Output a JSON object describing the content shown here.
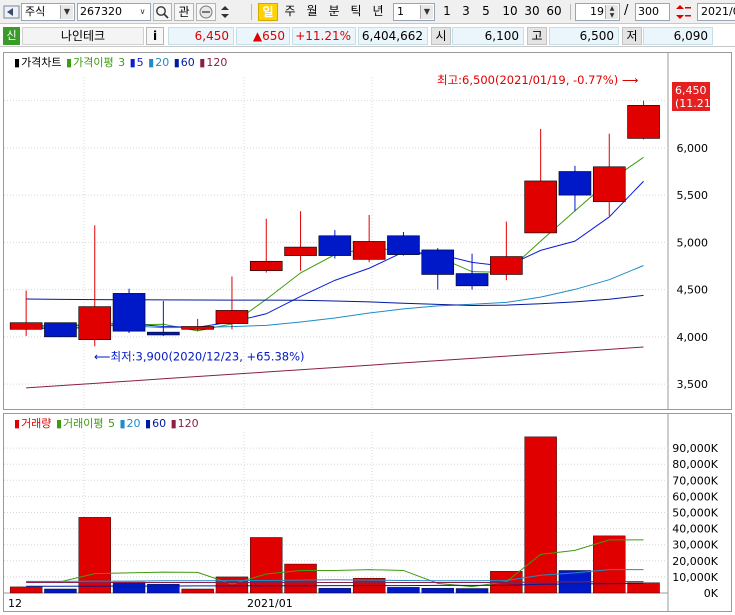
{
  "toolbar": {
    "market_select": "주식",
    "code_input": "267320",
    "search_icon": "search-icon",
    "btn_gwan": "관",
    "periods": [
      "일",
      "주",
      "월",
      "분",
      "틱",
      "년"
    ],
    "active_period": "일",
    "interval_select": "1",
    "intervals": [
      "1",
      "3",
      "5",
      "10",
      "30",
      "60"
    ],
    "count_value": "19",
    "slash": "/",
    "total_value": "300",
    "date_value": "2021/0"
  },
  "quote": {
    "badge": "신",
    "name": "나인테크",
    "info_button": "i",
    "price": "6,450",
    "change": "▲650",
    "change_pct": "+11.21%",
    "volume": "6,404,662",
    "open_label": "시",
    "open": "6,100",
    "high_label": "고",
    "high": "6,500",
    "low_label": "저",
    "low": "6,090"
  },
  "colors": {
    "up": "#e00000",
    "down": "#0019c8",
    "ma3": "#3f9b10",
    "ma5": "#0a1ed7",
    "ma20": "#1e8cc8",
    "ma60": "#001a9f",
    "ma120": "#8c1e46",
    "grid": "#d8d8d8",
    "toolbar_active": "#ffd200"
  },
  "price_legend": {
    "title": "가격차트",
    "ma_title": "가격이평",
    "ma_periods": [
      "3",
      "5",
      "20",
      "60",
      "120"
    ]
  },
  "volume_legend": {
    "title": "거래량",
    "ma_title": "거래이평",
    "ma_periods": [
      "5",
      "20",
      "60",
      "120"
    ]
  },
  "annotations": {
    "high_note": "최고:6,500(2021/01/19, -0.77%)",
    "low_note": "최저:3,900(2020/12/23, +65.38%)",
    "last_price_box": "6,450",
    "last_pct_box": "(11.21%)"
  },
  "chart_data": [
    {
      "type": "candlestick",
      "title": "가격차트",
      "ylim": [
        3300,
        6750
      ],
      "yticks": [
        3500,
        4000,
        4500,
        5000,
        5500,
        6000,
        6500
      ],
      "ytick_labels": [
        "3,500",
        "4,000",
        "4,500",
        "5,000",
        "5,500",
        "6,000",
        "6,500"
      ],
      "x_labels": [
        "12",
        "2021/01"
      ],
      "candles": [
        {
          "open": 4080,
          "high": 4490,
          "low": 4010,
          "close": 4150
        },
        {
          "open": 4150,
          "high": 4150,
          "low": 4000,
          "close": 4000
        },
        {
          "open": 3970,
          "high": 5180,
          "low": 3900,
          "close": 4320
        },
        {
          "open": 4460,
          "high": 4510,
          "low": 4040,
          "close": 4060
        },
        {
          "open": 4050,
          "high": 4380,
          "low": 4010,
          "close": 4020
        },
        {
          "open": 4080,
          "high": 4190,
          "low": 4060,
          "close": 4110
        },
        {
          "open": 4140,
          "high": 4640,
          "low": 4080,
          "close": 4280
        },
        {
          "open": 4700,
          "high": 5250,
          "low": 4680,
          "close": 4800
        },
        {
          "open": 4860,
          "high": 5330,
          "low": 4700,
          "close": 4950
        },
        {
          "open": 5070,
          "high": 5130,
          "low": 4830,
          "close": 4860
        },
        {
          "open": 4820,
          "high": 5290,
          "low": 4790,
          "close": 5010
        },
        {
          "open": 5070,
          "high": 5110,
          "low": 4860,
          "close": 4870
        },
        {
          "open": 4920,
          "high": 4940,
          "low": 4500,
          "close": 4660
        },
        {
          "open": 4670,
          "high": 4880,
          "low": 4500,
          "close": 4540
        },
        {
          "open": 4660,
          "high": 5220,
          "low": 4600,
          "close": 4850
        },
        {
          "open": 5100,
          "high": 6200,
          "low": 5100,
          "close": 5650
        },
        {
          "open": 5750,
          "high": 5810,
          "low": 5330,
          "close": 5500
        },
        {
          "open": 5430,
          "high": 6150,
          "low": 5280,
          "close": 5800
        },
        {
          "open": 6100,
          "high": 6500,
          "low": 6090,
          "close": 6450
        }
      ],
      "series": [
        {
          "name": "3",
          "values": [
            4120,
            4090,
            4160,
            4127,
            4133,
            4063,
            4137,
            4397,
            4677,
            4870,
            4940,
            4913,
            4847,
            4690,
            4683,
            5013,
            5333,
            5650,
            5900
          ]
        },
        {
          "name": "5",
          "values": [
            4100,
            4080,
            4110,
            4140,
            4110,
            4102,
            4158,
            4244,
            4428,
            4598,
            4726,
            4898,
            4878,
            4788,
            4746,
            4915,
            5013,
            5269,
            5647
          ]
        },
        {
          "name": "20",
          "values": [
            4120,
            4116,
            4119,
            4118,
            4098,
            4100,
            4108,
            4122,
            4157,
            4200,
            4252,
            4296,
            4328,
            4345,
            4365,
            4420,
            4502,
            4605,
            4755
          ]
        },
        {
          "name": "60",
          "values": [
            4400,
            4396,
            4394,
            4393,
            4391,
            4390,
            4389,
            4389,
            4388,
            4380,
            4370,
            4355,
            4344,
            4332,
            4336,
            4350,
            4370,
            4398,
            4439
          ]
        },
        {
          "name": "120",
          "values": [
            3460,
            3484,
            3508,
            3532,
            3556,
            3580,
            3604,
            3628,
            3652,
            3676,
            3700,
            3724,
            3748,
            3772,
            3796,
            3820,
            3844,
            3868,
            3892
          ]
        }
      ]
    },
    {
      "type": "bar",
      "title": "거래량",
      "ylim": [
        0,
        100000
      ],
      "yticks": [
        0,
        10000,
        20000,
        30000,
        40000,
        50000,
        60000,
        70000,
        80000,
        90000
      ],
      "ytick_labels": [
        "0K",
        "10,000K",
        "20,000K",
        "30,000K",
        "40,000K",
        "50,000K",
        "60,000K",
        "70,000K",
        "80,000K",
        "90,000K"
      ],
      "values": [
        3800,
        2500,
        47000,
        6800,
        5500,
        2500,
        10000,
        34500,
        18000,
        3000,
        9200,
        3500,
        3000,
        2800,
        13500,
        97000,
        14000,
        35500,
        6400
      ],
      "series": [
        {
          "name": "5",
          "values": [
            7000,
            7000,
            12000,
            12500,
            13000,
            12800,
            5500,
            11800,
            14000,
            14000,
            14500,
            14000,
            6000,
            4000,
            7000,
            24000,
            26500,
            33000,
            33000
          ]
        },
        {
          "name": "20",
          "values": [
            7200,
            7200,
            7400,
            7400,
            7600,
            7600,
            7700,
            7800,
            8000,
            8200,
            8000,
            7800,
            7600,
            7600,
            7800,
            11000,
            12500,
            14500,
            14500
          ]
        },
        {
          "name": "60",
          "values": [
            4200,
            4200,
            4300,
            4300,
            4300,
            4400,
            4400,
            4500,
            4500,
            4600,
            4600,
            4600,
            4700,
            4700,
            4800,
            5400,
            5600,
            5800,
            5900
          ]
        },
        {
          "name": "120",
          "values": [
            6500,
            6500,
            6500,
            6500,
            6500,
            6500,
            6500,
            6500,
            6500,
            6500,
            6500,
            6500,
            6500,
            6500,
            6500,
            6800,
            6900,
            7000,
            7100
          ]
        }
      ]
    }
  ]
}
